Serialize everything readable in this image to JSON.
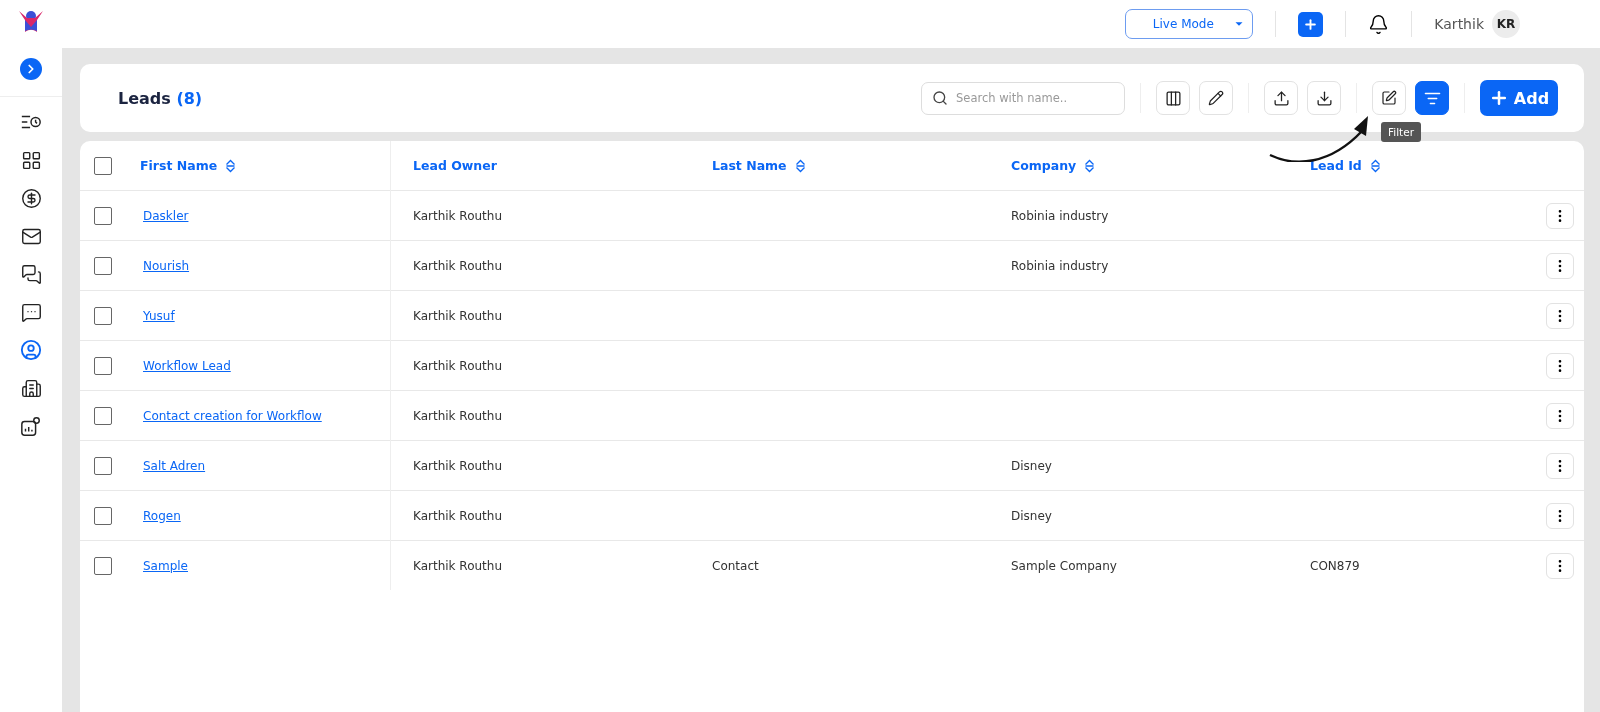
{
  "sidebar": {
    "items": [
      {
        "selected": false
      },
      {
        "selected": false
      },
      {
        "selected": false
      },
      {
        "selected": false
      },
      {
        "selected": false
      },
      {
        "selected": false
      },
      {
        "selected": true
      },
      {
        "selected": false
      },
      {
        "selected": false
      }
    ]
  },
  "topbar": {
    "mode": "Live Mode",
    "user": "Karthik",
    "initials": "KR"
  },
  "header": {
    "title": "Leads",
    "count": "(8)",
    "search": {
      "placeholder": "Search with name.."
    },
    "tools": [
      {
        "kind": "columns",
        "active": false
      },
      {
        "kind": "edit",
        "active": false
      },
      {
        "kind": "upload",
        "active": false
      },
      {
        "kind": "download",
        "active": false
      },
      {
        "kind": "bulk-edit",
        "active": false
      },
      {
        "kind": "filter",
        "active": true
      }
    ],
    "tooltip": "Filter",
    "add": "Add"
  },
  "table": {
    "all_checked": false,
    "columns": [
      {
        "label": "First Name",
        "sortable": true
      },
      {
        "label": "Lead Owner",
        "sortable": false
      },
      {
        "label": "Last Name",
        "sortable": true
      },
      {
        "label": "Company",
        "sortable": true
      },
      {
        "label": "Lead Id",
        "sortable": true
      }
    ],
    "rows": [
      {
        "checked": false,
        "cells": [
          "Daskler",
          "Karthik Routhu",
          "",
          "Robinia industry",
          ""
        ]
      },
      {
        "checked": false,
        "cells": [
          "Nourish",
          "Karthik Routhu",
          "",
          "Robinia industry",
          ""
        ]
      },
      {
        "checked": false,
        "cells": [
          "Yusuf",
          "Karthik Routhu",
          "",
          "",
          ""
        ]
      },
      {
        "checked": false,
        "cells": [
          "Workflow Lead",
          "Karthik Routhu",
          "",
          "",
          ""
        ]
      },
      {
        "checked": false,
        "cells": [
          "Contact creation for Workflow",
          "Karthik Routhu",
          "",
          "",
          ""
        ]
      },
      {
        "checked": false,
        "cells": [
          "Salt Adren",
          "Karthik Routhu",
          "",
          "Disney",
          ""
        ]
      },
      {
        "checked": false,
        "cells": [
          "Rogen",
          "Karthik Routhu",
          "",
          "Disney",
          ""
        ]
      },
      {
        "checked": false,
        "cells": [
          "Sample",
          "Karthik Routhu",
          "Contact",
          "Sample Company",
          "CON879"
        ]
      }
    ]
  }
}
